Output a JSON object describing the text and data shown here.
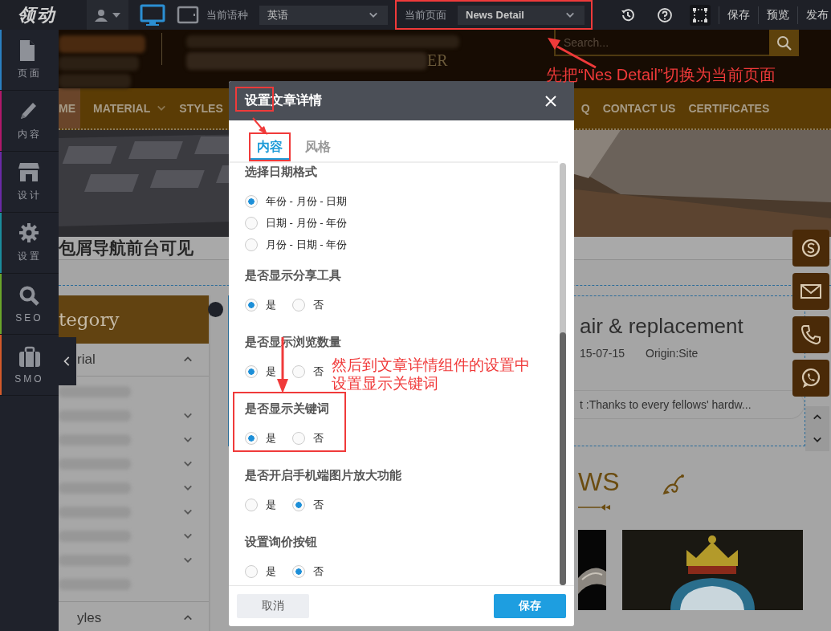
{
  "toolbar": {
    "logo": "领动",
    "devices": [
      {
        "kind": "desktop",
        "selected": true
      },
      {
        "kind": "tablet",
        "selected": false
      }
    ],
    "language_label": "当前语种",
    "language": "英语",
    "page_label": "当前页面",
    "page": "News Detail",
    "page_highlighted": true,
    "actions": [
      "保存",
      "预览",
      "发布"
    ]
  },
  "sidebar": {
    "items": [
      {
        "label": "页面",
        "kind": "page",
        "color": "#2a7fc1"
      },
      {
        "label": "内容",
        "kind": "content",
        "color": "#b0186a"
      },
      {
        "label": "设计",
        "kind": "design",
        "color": "#6a2aa6"
      },
      {
        "label": "设置",
        "kind": "settings",
        "color": "#1b8c9c"
      },
      {
        "label": "SEO",
        "kind": "seo",
        "color": "#6aa52a"
      },
      {
        "label": "SMO",
        "kind": "smo",
        "color": "#d45a2a"
      }
    ]
  },
  "site": {
    "header_text": "ER",
    "search": {
      "placeholder": "Search..."
    },
    "nav": [
      {
        "label": "ME",
        "selected": true,
        "dropdown": false
      },
      {
        "label": "MATERIAL",
        "selected": false,
        "dropdown": true
      },
      {
        "label": "STYLES",
        "selected": false,
        "dropdown": false
      },
      {
        "label": "Q",
        "selected": false,
        "dropdown": false
      },
      {
        "label": "CONTACT US",
        "selected": false,
        "dropdown": false
      },
      {
        "label": "CERTIFICATES",
        "selected": false,
        "dropdown": false
      }
    ],
    "breadcrumb_note": "包屑导航前台可见",
    "category": {
      "title": "tegory",
      "groups": [
        {
          "label": "rial",
          "expanded": true,
          "children": [
            {
              "has_children": false
            },
            {
              "has_children": true
            },
            {
              "has_children": true
            },
            {
              "has_children": true
            },
            {
              "has_children": true
            },
            {
              "has_children": true
            },
            {
              "has_children": true
            },
            {
              "has_children": true
            },
            {
              "has_children": false
            }
          ]
        },
        {
          "label": "yles",
          "expanded": true
        }
      ]
    },
    "article": {
      "title": "air & replacement",
      "date": "15-07-15",
      "origin": "Origin:Site",
      "summary": "t :Thanks to every fellows' hardw..."
    },
    "news": {
      "heading": "WS"
    }
  },
  "dialog": {
    "title": "设置文章详情",
    "title_highlighted": true,
    "tabs": [
      {
        "label": "内容",
        "selected": true,
        "highlighted": true
      },
      {
        "label": "风格",
        "selected": false,
        "highlighted": false
      }
    ],
    "sections": [
      {
        "label": "选择日期格式",
        "kind": "column",
        "highlighted": false,
        "options": [
          {
            "label": "年份 - 月份 - 日期",
            "selected": true
          },
          {
            "label": "日期 - 月份 - 年份",
            "selected": false
          },
          {
            "label": "月份 - 日期 - 年份",
            "selected": false
          }
        ]
      },
      {
        "label": "是否显示分享工具",
        "kind": "row",
        "highlighted": false,
        "options": [
          {
            "label": "是",
            "selected": true
          },
          {
            "label": "否",
            "selected": false
          }
        ]
      },
      {
        "label": "是否显示浏览数量",
        "kind": "row",
        "highlighted": false,
        "options": [
          {
            "label": "是",
            "selected": true
          },
          {
            "label": "否",
            "selected": false
          }
        ]
      },
      {
        "label": "是否显示关键词",
        "kind": "row",
        "highlighted": true,
        "options": [
          {
            "label": "是",
            "selected": true
          },
          {
            "label": "否",
            "selected": false
          }
        ]
      },
      {
        "label": "是否开启手机端图片放大功能",
        "kind": "row",
        "highlighted": false,
        "options": [
          {
            "label": "是",
            "selected": false
          },
          {
            "label": "否",
            "selected": true
          }
        ]
      },
      {
        "label": "设置询价按钮",
        "kind": "row",
        "highlighted": false,
        "options": [
          {
            "label": "是",
            "selected": false
          },
          {
            "label": "否",
            "selected": true
          }
        ]
      }
    ],
    "buttons": [
      {
        "label": "取消",
        "kind": "secondary"
      },
      {
        "label": "保存",
        "kind": "primary"
      }
    ]
  },
  "annotations": [
    {
      "text": "先把“Nes Detail”切换为当前页面"
    },
    {
      "text": "然后到文章详情组件的设置中设置显示关键词"
    }
  ]
}
